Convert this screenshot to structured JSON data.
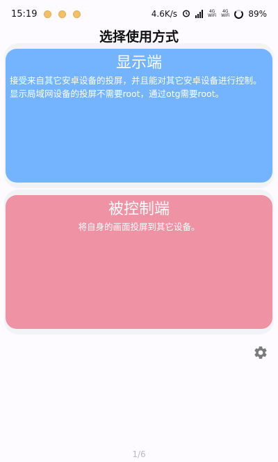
{
  "status_bar": {
    "time": "15:19",
    "network_speed": "4.6K/s",
    "wifi_label_1_top": "4G",
    "wifi_label_1_bottom": "WiFi",
    "wifi_label_2_top": "4G",
    "wifi_label_2_bottom": "WiFi",
    "battery": "89%"
  },
  "header": {
    "title": "选择使用方式"
  },
  "cards": {
    "display": {
      "title": "显示端",
      "description": "接受来自其它安卓设备的投屏，并且能对其它安卓设备进行控制。显示局域网设备的投屏不需要root，通过otg需要root。",
      "color": "#74b3fe"
    },
    "controlled": {
      "title": "被控制端",
      "description": "将自身的画面投屏到其它设备。",
      "color": "#ef92a4"
    }
  },
  "footer": {
    "page_indicator": "1/6"
  },
  "icons": {
    "settings": "gear-icon",
    "alarm": "alarm-icon",
    "battery": "battery-icon"
  }
}
